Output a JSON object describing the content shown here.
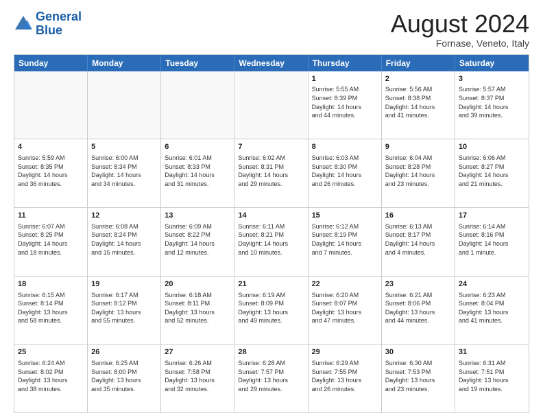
{
  "logo": {
    "line1": "General",
    "line2": "Blue"
  },
  "title": "August 2024",
  "location": "Fornase, Veneto, Italy",
  "days": [
    "Sunday",
    "Monday",
    "Tuesday",
    "Wednesday",
    "Thursday",
    "Friday",
    "Saturday"
  ],
  "rows": [
    [
      {
        "day": "",
        "text": ""
      },
      {
        "day": "",
        "text": ""
      },
      {
        "day": "",
        "text": ""
      },
      {
        "day": "",
        "text": ""
      },
      {
        "day": "1",
        "text": "Sunrise: 5:55 AM\nSunset: 8:39 PM\nDaylight: 14 hours\nand 44 minutes."
      },
      {
        "day": "2",
        "text": "Sunrise: 5:56 AM\nSunset: 8:38 PM\nDaylight: 14 hours\nand 41 minutes."
      },
      {
        "day": "3",
        "text": "Sunrise: 5:57 AM\nSunset: 8:37 PM\nDaylight: 14 hours\nand 39 minutes."
      }
    ],
    [
      {
        "day": "4",
        "text": "Sunrise: 5:59 AM\nSunset: 8:35 PM\nDaylight: 14 hours\nand 36 minutes."
      },
      {
        "day": "5",
        "text": "Sunrise: 6:00 AM\nSunset: 8:34 PM\nDaylight: 14 hours\nand 34 minutes."
      },
      {
        "day": "6",
        "text": "Sunrise: 6:01 AM\nSunset: 8:33 PM\nDaylight: 14 hours\nand 31 minutes."
      },
      {
        "day": "7",
        "text": "Sunrise: 6:02 AM\nSunset: 8:31 PM\nDaylight: 14 hours\nand 29 minutes."
      },
      {
        "day": "8",
        "text": "Sunrise: 6:03 AM\nSunset: 8:30 PM\nDaylight: 14 hours\nand 26 minutes."
      },
      {
        "day": "9",
        "text": "Sunrise: 6:04 AM\nSunset: 8:28 PM\nDaylight: 14 hours\nand 23 minutes."
      },
      {
        "day": "10",
        "text": "Sunrise: 6:06 AM\nSunset: 8:27 PM\nDaylight: 14 hours\nand 21 minutes."
      }
    ],
    [
      {
        "day": "11",
        "text": "Sunrise: 6:07 AM\nSunset: 8:25 PM\nDaylight: 14 hours\nand 18 minutes."
      },
      {
        "day": "12",
        "text": "Sunrise: 6:08 AM\nSunset: 8:24 PM\nDaylight: 14 hours\nand 15 minutes."
      },
      {
        "day": "13",
        "text": "Sunrise: 6:09 AM\nSunset: 8:22 PM\nDaylight: 14 hours\nand 12 minutes."
      },
      {
        "day": "14",
        "text": "Sunrise: 6:11 AM\nSunset: 8:21 PM\nDaylight: 14 hours\nand 10 minutes."
      },
      {
        "day": "15",
        "text": "Sunrise: 6:12 AM\nSunset: 8:19 PM\nDaylight: 14 hours\nand 7 minutes."
      },
      {
        "day": "16",
        "text": "Sunrise: 6:13 AM\nSunset: 8:17 PM\nDaylight: 14 hours\nand 4 minutes."
      },
      {
        "day": "17",
        "text": "Sunrise: 6:14 AM\nSunset: 8:16 PM\nDaylight: 14 hours\nand 1 minute."
      }
    ],
    [
      {
        "day": "18",
        "text": "Sunrise: 6:15 AM\nSunset: 8:14 PM\nDaylight: 13 hours\nand 58 minutes."
      },
      {
        "day": "19",
        "text": "Sunrise: 6:17 AM\nSunset: 8:12 PM\nDaylight: 13 hours\nand 55 minutes."
      },
      {
        "day": "20",
        "text": "Sunrise: 6:18 AM\nSunset: 8:11 PM\nDaylight: 13 hours\nand 52 minutes."
      },
      {
        "day": "21",
        "text": "Sunrise: 6:19 AM\nSunset: 8:09 PM\nDaylight: 13 hours\nand 49 minutes."
      },
      {
        "day": "22",
        "text": "Sunrise: 6:20 AM\nSunset: 8:07 PM\nDaylight: 13 hours\nand 47 minutes."
      },
      {
        "day": "23",
        "text": "Sunrise: 6:21 AM\nSunset: 8:06 PM\nDaylight: 13 hours\nand 44 minutes."
      },
      {
        "day": "24",
        "text": "Sunrise: 6:23 AM\nSunset: 8:04 PM\nDaylight: 13 hours\nand 41 minutes."
      }
    ],
    [
      {
        "day": "25",
        "text": "Sunrise: 6:24 AM\nSunset: 8:02 PM\nDaylight: 13 hours\nand 38 minutes."
      },
      {
        "day": "26",
        "text": "Sunrise: 6:25 AM\nSunset: 8:00 PM\nDaylight: 13 hours\nand 35 minutes."
      },
      {
        "day": "27",
        "text": "Sunrise: 6:26 AM\nSunset: 7:58 PM\nDaylight: 13 hours\nand 32 minutes."
      },
      {
        "day": "28",
        "text": "Sunrise: 6:28 AM\nSunset: 7:57 PM\nDaylight: 13 hours\nand 29 minutes."
      },
      {
        "day": "29",
        "text": "Sunrise: 6:29 AM\nSunset: 7:55 PM\nDaylight: 13 hours\nand 26 minutes."
      },
      {
        "day": "30",
        "text": "Sunrise: 6:30 AM\nSunset: 7:53 PM\nDaylight: 13 hours\nand 23 minutes."
      },
      {
        "day": "31",
        "text": "Sunrise: 6:31 AM\nSunset: 7:51 PM\nDaylight: 13 hours\nand 19 minutes."
      }
    ]
  ]
}
